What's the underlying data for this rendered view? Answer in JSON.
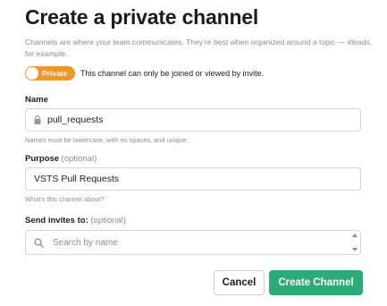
{
  "dialog": {
    "title": "Create a private channel",
    "description": "Channels are where your team communicates. They’re best when organized around a topic — #leads, for example."
  },
  "privacy": {
    "toggle_label": "Private",
    "toggle_on": true,
    "description": "This channel can only be joined or viewed by invite.",
    "accent_color": "#f0962a"
  },
  "name_field": {
    "label": "Name",
    "value": "pull_requests",
    "hint": "Names must be lowercase, with no spaces, and unique.",
    "icon": "lock-icon"
  },
  "purpose_field": {
    "label": "Purpose",
    "optional_label": "(optional)",
    "value": "VSTS Pull Requests",
    "hint": "What’s this channel about?"
  },
  "invites_field": {
    "label": "Send invites to:",
    "optional_label": "(optional)",
    "placeholder": "Search by name",
    "icon": "search-icon"
  },
  "buttons": {
    "cancel_label": "Cancel",
    "create_label": "Create Channel",
    "create_color": "#2bac76"
  }
}
